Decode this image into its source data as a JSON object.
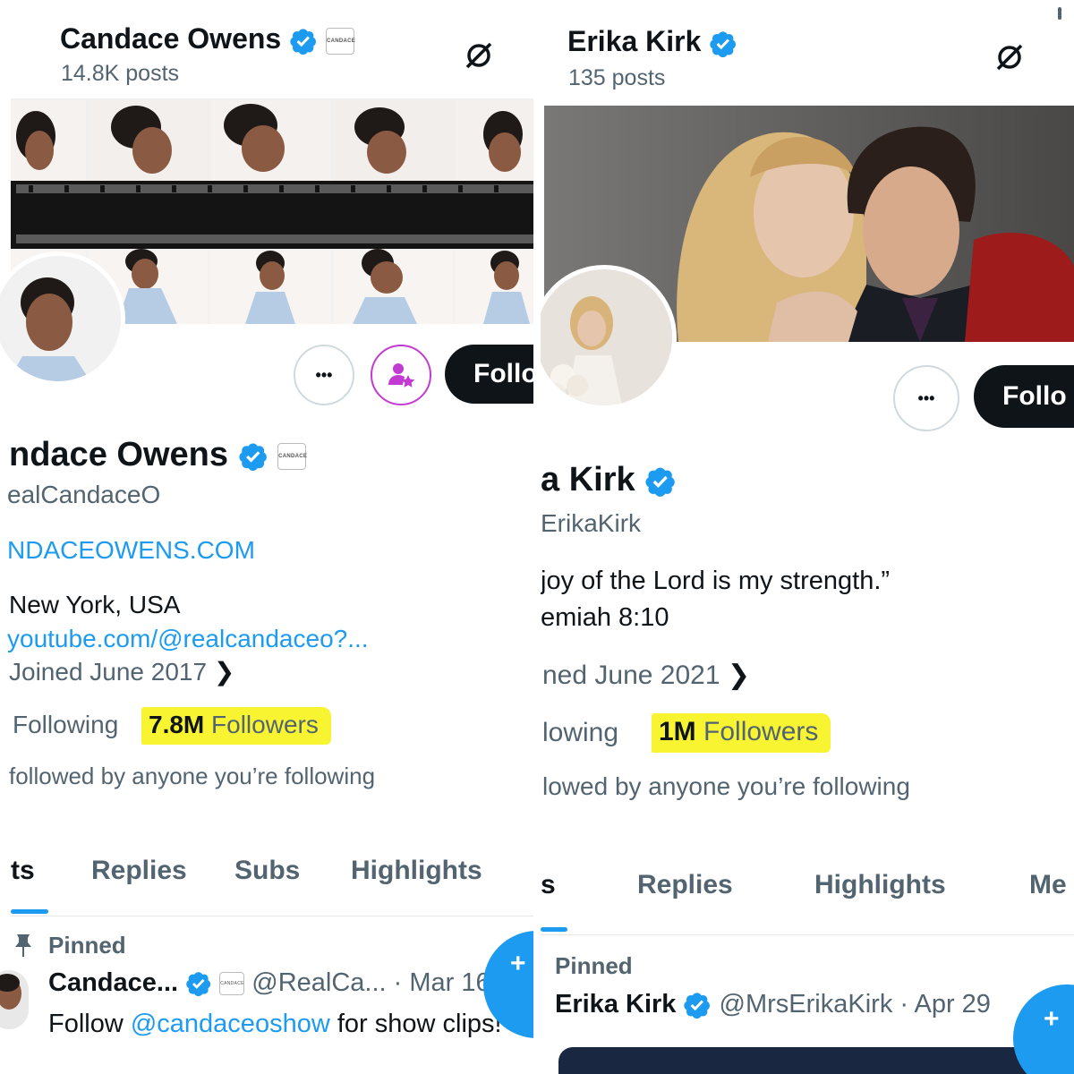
{
  "left": {
    "header": {
      "name": "Candace Owens",
      "posts": "14.8K posts",
      "affiliate_badge": "CANDACE"
    },
    "profile": {
      "name": "ndace Owens",
      "handle": "ealCandaceO",
      "website": "NDACEOWENS.COM",
      "location": "New York, USA",
      "link": "youtube.com/@realcandaceo?...",
      "joined": "Joined June 2017",
      "following_label": "Following",
      "followers_count": "7.8M",
      "followers_label": "Followers",
      "followed_by": "followed by anyone you’re following"
    },
    "actions": {
      "more": "•••",
      "follow": "Follo"
    },
    "tabs": [
      {
        "label": "ts"
      },
      {
        "label": "Replies"
      },
      {
        "label": "Subs"
      },
      {
        "label": "Highlights"
      }
    ],
    "pinned_tweet": {
      "pinned_label": "Pinned",
      "author": "Candace...",
      "handle_date": "@RealCa... · Mar 16",
      "text_prefix": "Follow ",
      "mention": "@candaceoshow",
      "text_suffix": " for show clips!"
    },
    "fab_label": "+"
  },
  "right": {
    "header": {
      "name": "Erika Kirk",
      "posts": "135 posts"
    },
    "profile": {
      "name": "a Kirk",
      "handle": "ErikaKirk",
      "bio_line1": "joy of the Lord is my strength.”",
      "bio_line2": "emiah 8:10",
      "joined": "ned June 2021",
      "following_label": "lowing",
      "followers_count": "1M",
      "followers_label": "Followers",
      "followed_by": "lowed by anyone you’re following"
    },
    "actions": {
      "more": "•••",
      "follow": "Follo"
    },
    "tabs": [
      {
        "label": "s"
      },
      {
        "label": "Replies"
      },
      {
        "label": "Highlights"
      },
      {
        "label": "Me"
      }
    ],
    "pinned_tweet": {
      "pinned_label": "Pinned",
      "author": "Erika Kirk",
      "handle_date": "@MrsErikaKirk · Apr 29"
    },
    "fab_label": "+"
  },
  "colors": {
    "accent": "#1d9bf0",
    "highlight": "#f8f432",
    "dark": "#0f1419",
    "muted": "#536471",
    "subscribe_ring": "#c13bd1"
  },
  "icons": [
    "verified-badge-icon",
    "no-symbol-icon",
    "pin-icon",
    "subscribe-star-icon",
    "chevron-right-icon",
    "compose-plus-icon"
  ]
}
